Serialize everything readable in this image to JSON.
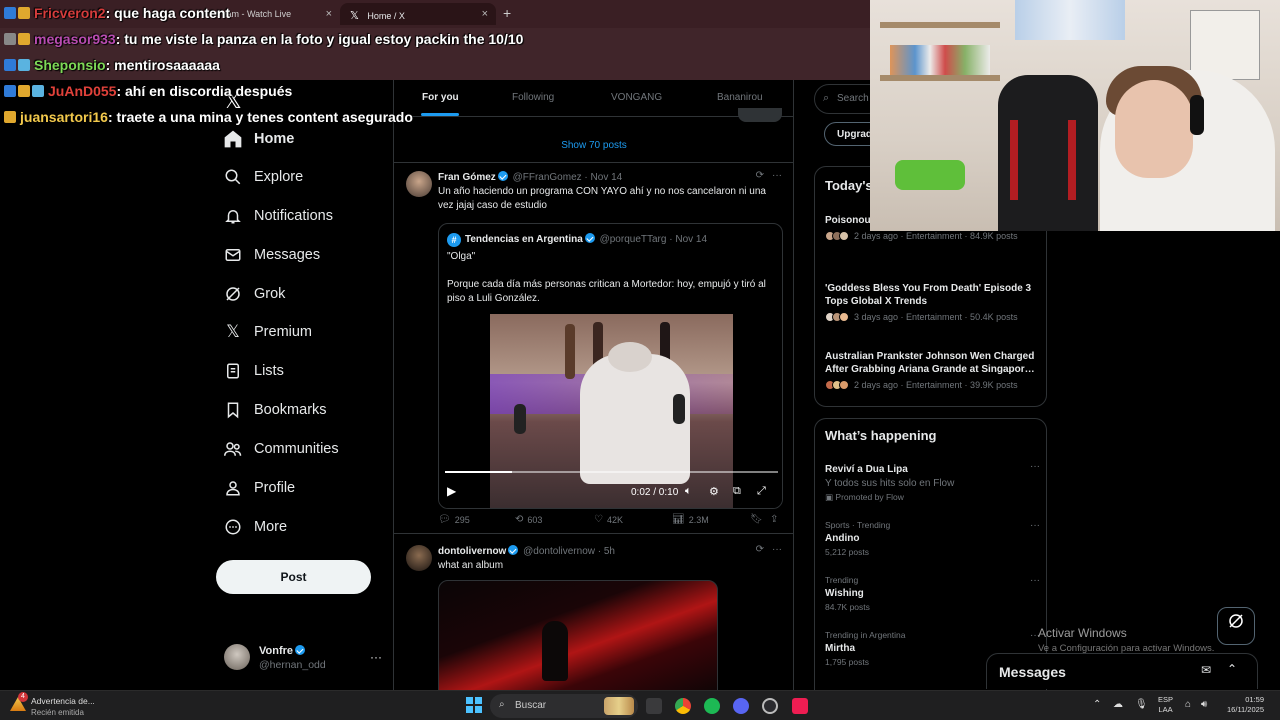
{
  "browser": {
    "tabs": [
      {
        "label": "Stream - Watch Live"
      },
      {
        "label": "Home / X"
      }
    ],
    "new_tab": "+",
    "close": "×"
  },
  "chat": [
    {
      "user": "Fricveron2",
      "message": ": que haga content",
      "user_color": "#d43c3c"
    },
    {
      "user": "megasor933",
      "message": ": tu me viste la panza en la foto y igual estoy packin the 10/10",
      "user_color": "#b84cb0"
    },
    {
      "user": "Sheponsio",
      "message": ": mentirosaaaaaa",
      "user_color": "#7ed957"
    },
    {
      "user": "JuAnD055",
      "message": ": ahí en discordia después",
      "user_color": "#e0413a"
    },
    {
      "user": "juansartori16",
      "message": ": traete a una mina y tenes content asegurado",
      "user_color": "#f2c94c"
    }
  ],
  "sidebar": {
    "logo": "𝕏",
    "items": [
      {
        "label": "Home",
        "icon": "home-icon"
      },
      {
        "label": "Explore",
        "icon": "search-icon"
      },
      {
        "label": "Notifications",
        "icon": "bell-icon"
      },
      {
        "label": "Messages",
        "icon": "mail-icon"
      },
      {
        "label": "Grok",
        "icon": "grok-icon"
      },
      {
        "label": "Premium",
        "icon": "x-icon"
      },
      {
        "label": "Lists",
        "icon": "list-icon"
      },
      {
        "label": "Bookmarks",
        "icon": "bookmark-icon"
      },
      {
        "label": "Communities",
        "icon": "people-icon"
      },
      {
        "label": "Profile",
        "icon": "person-icon"
      },
      {
        "label": "More",
        "icon": "more-circle-icon"
      }
    ],
    "post_label": "Post",
    "account": {
      "name": "Vonfre",
      "handle": "@hernan_odd",
      "more": "···"
    }
  },
  "feed": {
    "tabs": [
      "For you",
      "Following",
      "VONGANG",
      "Bananirou"
    ],
    "show_posts": "Show 70 posts",
    "tweet1": {
      "name": "Fran Gómez",
      "handle": "@FFranGomez",
      "time": "Nov 14",
      "text": "Un año haciendo un programa CON YAYO ahí y no nos cancelaron ni una vez jajaj caso de estudio",
      "quote": {
        "avatar": "#",
        "name": "Tendencias en Argentina",
        "handle": "@porqueTTarg",
        "time": "Nov 14",
        "line1": "\"Olga\"",
        "line2": "Porque cada día más personas critican a Mortedor: hoy, empujó y tiró al piso a Luli González.",
        "video_time": "0:02 / 0:10",
        "progress": 0.2
      },
      "replies": "295",
      "reposts": "603",
      "likes": "42K",
      "views": "2.3M"
    },
    "tweet2": {
      "name": "dontolivernow",
      "handle": "@dontolivernow",
      "time": "5h",
      "text": "what an album"
    },
    "more": "···",
    "sep": " · "
  },
  "right": {
    "search_placeholder": "Search",
    "upgrade": "Upgrade",
    "today_title": "Today's News",
    "news": [
      {
        "title": "Poisonous Heartbreaking Prem-Pat Breakup",
        "meta": "2 days ago · Entertainment · 84.9K posts"
      },
      {
        "title": "'Goddess Bless You From Death' Episode 3 Tops Global X Trends",
        "meta": "3 days ago · Entertainment · 50.4K posts"
      },
      {
        "title": "Australian Prankster Johnson Wen Charged After Grabbing Ariana Grande at Singapor…",
        "meta": "2 days ago · Entertainment · 39.9K posts"
      }
    ],
    "happening_title": "What’s happening",
    "trends": [
      {
        "category": "",
        "title": "Reviví a Dua Lipa",
        "count": "Y todos sus hits solo en Flow",
        "promo": "Promoted by Flow"
      },
      {
        "category": "Sports · Trending",
        "title": "Andino",
        "count": "5,212 posts",
        "promo": ""
      },
      {
        "category": "Trending",
        "title": "Wishing",
        "count": "84.7K posts",
        "promo": ""
      },
      {
        "category": "Trending in Argentina",
        "title": "Mirtha",
        "count": "1,795 posts",
        "promo": ""
      }
    ],
    "more": "···"
  },
  "overlay": {
    "activate_title": "Activar Windows",
    "activate_sub": "Ve a Configuración para activar Windows.",
    "messages_title": "Messages"
  },
  "taskbar": {
    "notif_count": "4",
    "notif_title": "Advertencia de...",
    "notif_sub": "Recién emitida",
    "search": "Buscar",
    "lang1": "ESP",
    "lang2": "LAA",
    "time": "01:59",
    "date": "16/11/2025"
  }
}
